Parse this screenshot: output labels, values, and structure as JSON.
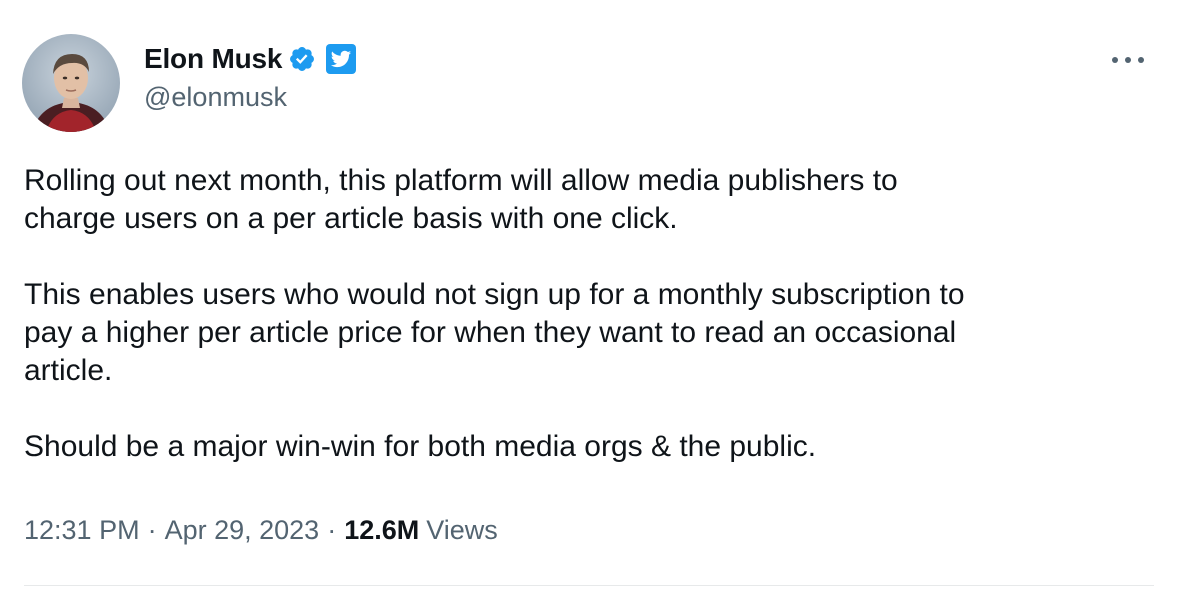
{
  "author": {
    "display_name": "Elon Musk",
    "handle": "@elonmusk",
    "verified_icon": "verified-badge-icon",
    "affiliate_icon": "twitter-bird-icon"
  },
  "menu": {
    "more_icon": "more-options-icon"
  },
  "tweet": {
    "paragraphs": [
      "Rolling out next month, this platform will allow media publishers to\ncharge users on a per article basis with one click.",
      "This enables users who would not sign up for a monthly subscription to\npay a higher per article price for when they want to read an occasional\narticle.",
      "Should be a major win-win for both media orgs & the public."
    ]
  },
  "meta": {
    "time": "12:31 PM",
    "separator": "·",
    "date": "Apr 29, 2023",
    "views_count": "12.6M",
    "views_label": "Views"
  },
  "colors": {
    "primary_text": "#0f1419",
    "secondary_text": "#536471",
    "accent": "#1d9bf0",
    "divider": "#e7e9ea"
  }
}
